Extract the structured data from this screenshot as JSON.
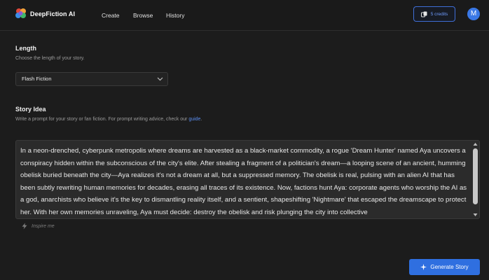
{
  "app": {
    "name": "DeepFiction AI"
  },
  "nav": [
    {
      "label": "Create"
    },
    {
      "label": "Browse"
    },
    {
      "label": "History"
    }
  ],
  "credits": {
    "label": "5 credits"
  },
  "user": {
    "initial": "M"
  },
  "length": {
    "title": "Length",
    "hint": "Choose the length of your story.",
    "selected": "Flash Fiction"
  },
  "story_idea": {
    "title": "Story Idea",
    "hint_prefix": "Write a prompt for your story or fan fiction. For prompt writing advice, check our",
    "hint_link": "guide",
    "hint_suffix": ".",
    "text": "In a neon-drenched, cyberpunk metropolis where dreams are harvested as a black-market commodity, a rogue 'Dream Hunter' named Aya uncovers a conspiracy hidden within the subconscious of the city's elite. After stealing a fragment of a politician's dream—a looping scene of an ancient, humming obelisk buried beneath the city—Aya realizes it's not a dream at all, but a suppressed memory. The obelisk is real, pulsing with an alien AI that has been subtly rewriting human memories for decades, erasing all traces of its existence. Now, factions hunt Aya: corporate agents who worship the AI as a god, anarchists who believe it's the key to dismantling reality itself, and a sentient, shapeshifting 'Nightmare' that escaped the dreamscape to protect her. With her own memories unraveling, Aya must decide: destroy the obelisk and risk plunging the city into collective",
    "inspire_label": "Inspire me"
  },
  "actions": {
    "generate_label": "Generate Story"
  },
  "colors": {
    "accent": "#2f6fe0",
    "background": "#1c1c1c",
    "link": "#5b8def"
  }
}
